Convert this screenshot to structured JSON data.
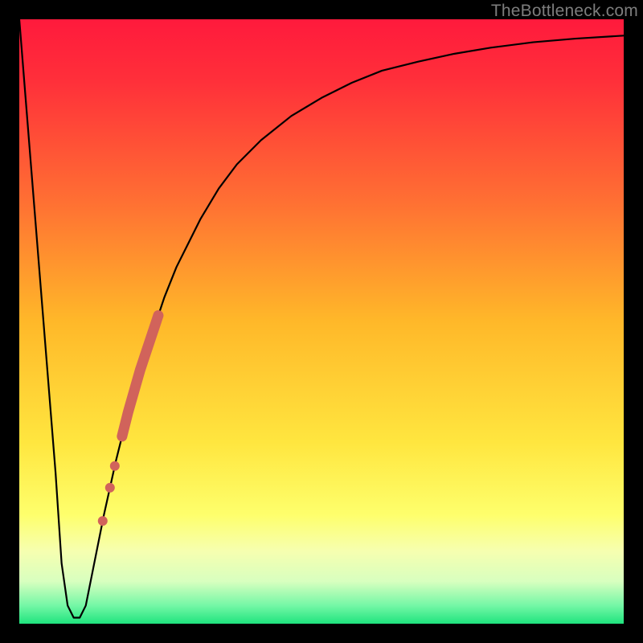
{
  "watermark": "TheBottleneck.com",
  "gradient_stops": [
    {
      "offset": 0.0,
      "color": "#ff1a3c"
    },
    {
      "offset": 0.1,
      "color": "#ff2f3a"
    },
    {
      "offset": 0.3,
      "color": "#ff6f33"
    },
    {
      "offset": 0.5,
      "color": "#ffb829"
    },
    {
      "offset": 0.7,
      "color": "#ffe63f"
    },
    {
      "offset": 0.82,
      "color": "#feff6c"
    },
    {
      "offset": 0.88,
      "color": "#f6ffb0"
    },
    {
      "offset": 0.93,
      "color": "#d8ffbf"
    },
    {
      "offset": 0.97,
      "color": "#74f7a6"
    },
    {
      "offset": 1.0,
      "color": "#1fe47e"
    }
  ],
  "curve_color": "#000000",
  "curve_width": 2.2,
  "dot_color": "#d1635b",
  "thick_segment_width": 13,
  "small_dot_radius": 6,
  "chart_data": {
    "type": "line",
    "title": "",
    "xlabel": "",
    "ylabel": "",
    "xlim": [
      0,
      100
    ],
    "ylim": [
      0,
      100
    ],
    "series": [
      {
        "name": "bottleneck-curve",
        "x": [
          0,
          2,
          4,
          6,
          7,
          8,
          9,
          10,
          11,
          12,
          14,
          16,
          18,
          20,
          22,
          24,
          26,
          28,
          30,
          33,
          36,
          40,
          45,
          50,
          55,
          60,
          66,
          72,
          78,
          85,
          92,
          100
        ],
        "y": [
          100,
          75,
          50,
          25,
          10,
          3,
          1,
          1,
          3,
          8,
          18,
          27,
          35,
          42,
          48,
          54,
          59,
          63,
          67,
          72,
          76,
          80,
          84,
          87,
          89.5,
          91.5,
          93,
          94.3,
          95.3,
          96.2,
          96.8,
          97.3
        ]
      }
    ],
    "highlight_segment": {
      "series": "bottleneck-curve",
      "x_start": 17,
      "x_end": 23,
      "style": "thick"
    },
    "highlight_dots": {
      "series": "bottleneck-curve",
      "x": [
        15.8,
        15.0,
        13.8
      ]
    }
  }
}
